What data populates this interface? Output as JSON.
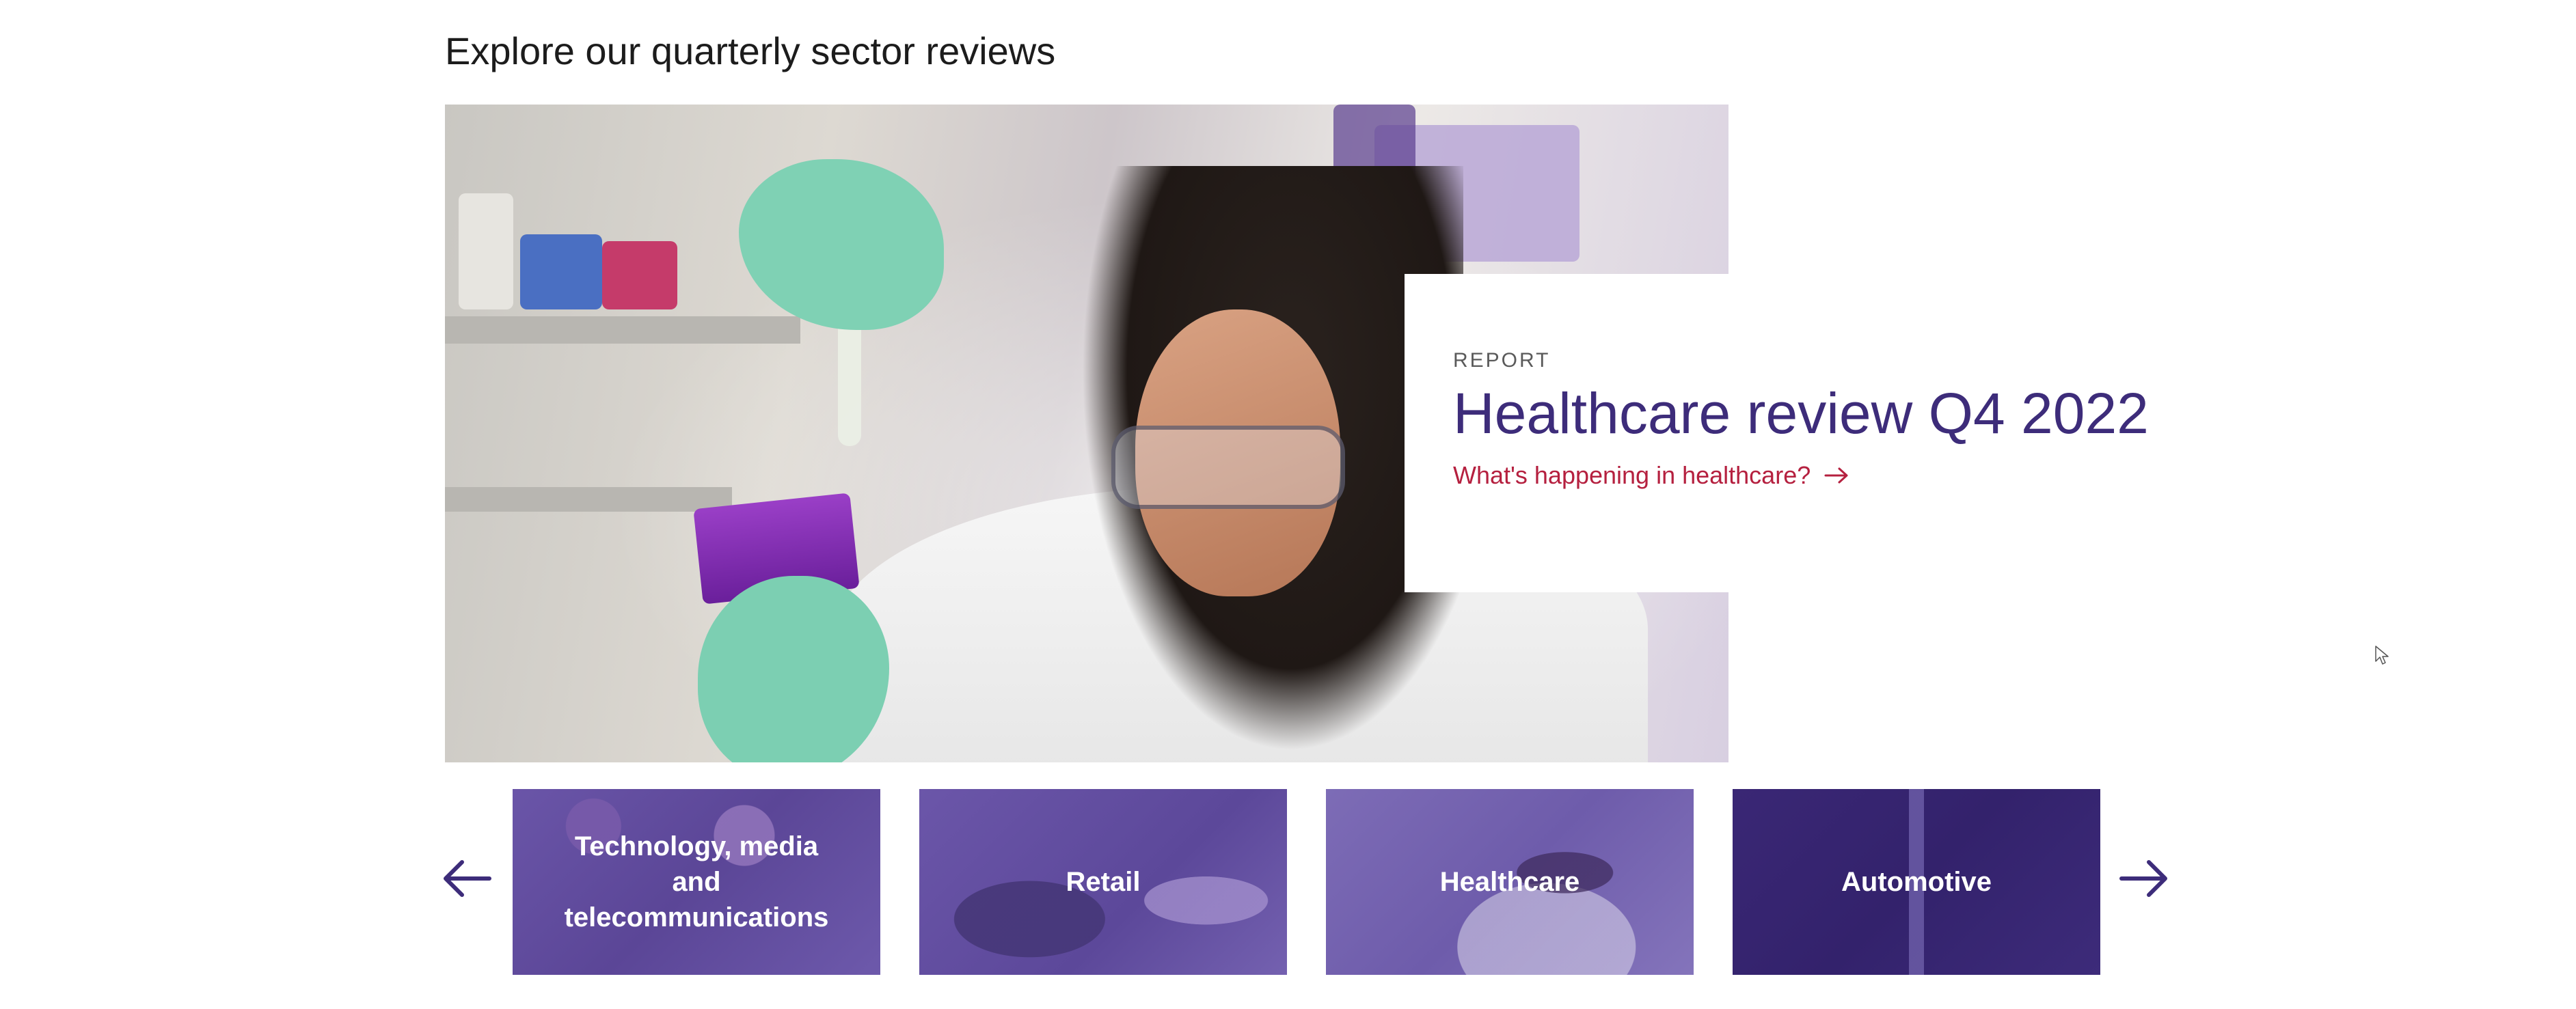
{
  "section": {
    "title": "Explore our quarterly sector reviews"
  },
  "hero": {
    "image_alt": "Scientist in a lab coat and safety goggles holding a test tube over a purple sample tray",
    "eyebrow": "REPORT",
    "title": "Healthcare review Q4 2022",
    "link_label": "What's happening in healthcare?"
  },
  "carousel": {
    "prev_icon": "arrow-left-icon",
    "next_icon": "arrow-right-icon",
    "tiles": [
      {
        "label": "Technology, media and telecommunications"
      },
      {
        "label": "Retail"
      },
      {
        "label": "Healthcare"
      },
      {
        "label": "Automotive"
      }
    ]
  },
  "colors": {
    "title_purple": "#3d2c7a",
    "link_red": "#b5203f",
    "tile_purple": "#5c489a",
    "tile_dark_purple": "#33226c"
  }
}
